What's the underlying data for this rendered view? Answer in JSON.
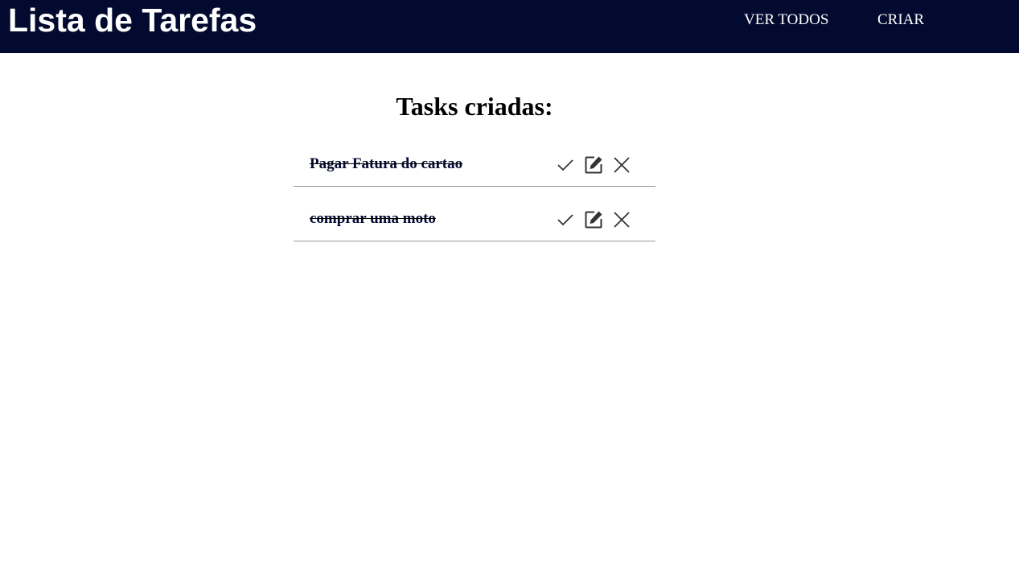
{
  "header": {
    "title": "Lista de Tarefas",
    "nav": [
      {
        "label": "VER TODOS"
      },
      {
        "label": "CRIAR"
      }
    ]
  },
  "main": {
    "heading": "Tasks criadas:",
    "tasks": [
      {
        "title": "Pagar Fatura do cartao",
        "completed": true
      },
      {
        "title": "comprar uma moto",
        "completed": true
      }
    ]
  },
  "icons": {
    "complete": "check-icon",
    "edit": "edit-icon",
    "delete": "close-icon"
  },
  "colors": {
    "header_bg": "#030a30",
    "header_text": "#ffffff",
    "task_text": "#030a30",
    "divider": "#9a9a9a",
    "icon": "#333333"
  }
}
